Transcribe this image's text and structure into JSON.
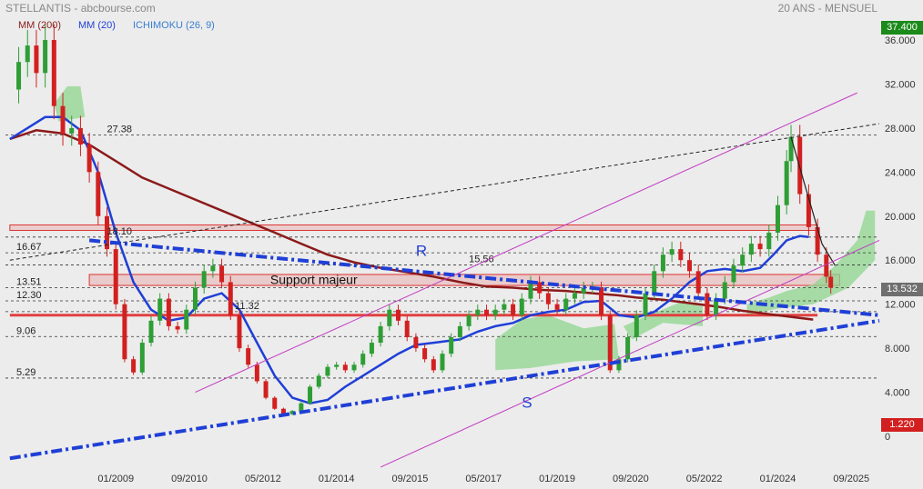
{
  "header": {
    "left": "STELLANTIS - abcbourse.com",
    "right": "20 ANS - MENSUEL"
  },
  "legend": [
    {
      "label": "MM (200)",
      "color": "#8b1a1a"
    },
    {
      "label": "MM (20)",
      "color": "#1f3fd6"
    },
    {
      "label": "ICHIMOKU (26, 9)",
      "color": "#3a7dd0"
    }
  ],
  "price_tags": {
    "high": "37.400",
    "last": "13.532",
    "low": "1.220"
  },
  "chart_data": {
    "type": "candlestick",
    "x_tick_labels": [
      "01/2009",
      "09/2010",
      "05/2012",
      "01/2014",
      "09/2015",
      "05/2017",
      "01/2019",
      "09/2020",
      "05/2022",
      "01/2024",
      "09/2025"
    ],
    "y_ticks": [
      0,
      4,
      8,
      12,
      16,
      20,
      24,
      28,
      32,
      36
    ],
    "y_tick_labels": [
      "0",
      "4.000",
      "8.000",
      "12.000",
      "16.000",
      "20.000",
      "24.000",
      "28.000",
      "32.000",
      "36.000"
    ],
    "ylim": [
      0,
      37.4
    ],
    "xlim": [
      2006.5,
      2026.3
    ],
    "colors": {
      "up": "#2e9e35",
      "down": "#d22020",
      "cloud": "#8fd68f",
      "ma200": "#8b1a1a",
      "ma20": "#1f3fd6",
      "trend": "#1f3fd6",
      "channel": "#c23cc2",
      "support": "#e04040"
    },
    "level_lines": [
      {
        "label": "27.38",
        "value": 27.38
      },
      {
        "label": "18.10",
        "value": 18.1
      },
      {
        "label": "16.67",
        "value": 16.67
      },
      {
        "label": "15.56",
        "value": 15.56
      },
      {
        "label": "13.51",
        "value": 13.51
      },
      {
        "label": "12.30",
        "value": 12.3
      },
      {
        "label": "11.32",
        "value": 11.32
      },
      {
        "label": "9.06",
        "value": 9.06
      },
      {
        "label": "5.29",
        "value": 5.29
      }
    ],
    "annotations": {
      "resistance": "R",
      "support": "S",
      "support_zone": "Support majeur"
    },
    "price_path": [
      [
        2006.6,
        31.5
      ],
      [
        2006.8,
        34.0
      ],
      [
        2007.0,
        35.5
      ],
      [
        2007.2,
        33.0
      ],
      [
        2007.4,
        36.0
      ],
      [
        2007.6,
        30.0
      ],
      [
        2007.8,
        27.5
      ],
      [
        2008.0,
        28.0
      ],
      [
        2008.2,
        26.5
      ],
      [
        2008.4,
        24.0
      ],
      [
        2008.6,
        20.0
      ],
      [
        2008.8,
        17.0
      ],
      [
        2009.0,
        12.0
      ],
      [
        2009.2,
        7.0
      ],
      [
        2009.4,
        5.8
      ],
      [
        2009.6,
        8.5
      ],
      [
        2009.8,
        10.5
      ],
      [
        2010.0,
        12.5
      ],
      [
        2010.2,
        10.0
      ],
      [
        2010.4,
        9.7
      ],
      [
        2010.6,
        11.5
      ],
      [
        2010.8,
        13.5
      ],
      [
        2011.0,
        15.0
      ],
      [
        2011.2,
        15.5
      ],
      [
        2011.4,
        14.0
      ],
      [
        2011.6,
        11.0
      ],
      [
        2011.8,
        8.0
      ],
      [
        2012.0,
        6.5
      ],
      [
        2012.2,
        5.0
      ],
      [
        2012.4,
        3.5
      ],
      [
        2012.6,
        2.5
      ],
      [
        2012.8,
        2.0
      ],
      [
        2013.0,
        2.3
      ],
      [
        2013.2,
        3.0
      ],
      [
        2013.4,
        4.5
      ],
      [
        2013.6,
        5.5
      ],
      [
        2013.8,
        6.3
      ],
      [
        2014.0,
        6.5
      ],
      [
        2014.2,
        6.0
      ],
      [
        2014.4,
        6.5
      ],
      [
        2014.6,
        7.5
      ],
      [
        2014.8,
        8.5
      ],
      [
        2015.0,
        10.0
      ],
      [
        2015.2,
        11.5
      ],
      [
        2015.4,
        10.5
      ],
      [
        2015.6,
        9.0
      ],
      [
        2015.8,
        8.0
      ],
      [
        2016.0,
        7.0
      ],
      [
        2016.2,
        6.0
      ],
      [
        2016.4,
        7.5
      ],
      [
        2016.6,
        9.0
      ],
      [
        2016.8,
        10.0
      ],
      [
        2017.0,
        11.0
      ],
      [
        2017.2,
        11.5
      ],
      [
        2017.4,
        11.0
      ],
      [
        2017.6,
        11.5
      ],
      [
        2017.8,
        12.0
      ],
      [
        2018.0,
        11.0
      ],
      [
        2018.2,
        12.5
      ],
      [
        2018.4,
        14.0
      ],
      [
        2018.6,
        13.0
      ],
      [
        2018.8,
        12.0
      ],
      [
        2019.0,
        11.5
      ],
      [
        2019.2,
        12.5
      ],
      [
        2019.4,
        13.0
      ],
      [
        2019.6,
        13.5
      ],
      [
        2019.8,
        13.5
      ],
      [
        2020.0,
        11.0
      ],
      [
        2020.2,
        6.0
      ],
      [
        2020.4,
        7.0
      ],
      [
        2020.6,
        9.0
      ],
      [
        2020.8,
        11.0
      ],
      [
        2021.0,
        13.0
      ],
      [
        2021.2,
        15.0
      ],
      [
        2021.4,
        16.5
      ],
      [
        2021.6,
        17.0
      ],
      [
        2021.8,
        16.0
      ],
      [
        2022.0,
        15.0
      ],
      [
        2022.2,
        13.0
      ],
      [
        2022.4,
        11.0
      ],
      [
        2022.6,
        12.5
      ],
      [
        2022.8,
        14.0
      ],
      [
        2023.0,
        15.5
      ],
      [
        2023.2,
        16.5
      ],
      [
        2023.4,
        17.5
      ],
      [
        2023.6,
        17.0
      ],
      [
        2023.8,
        18.5
      ],
      [
        2024.0,
        21.0
      ],
      [
        2024.2,
        25.0
      ],
      [
        2024.3,
        27.2
      ],
      [
        2024.5,
        22.0
      ],
      [
        2024.7,
        19.0
      ],
      [
        2024.9,
        16.5
      ],
      [
        2025.1,
        14.5
      ],
      [
        2025.2,
        13.5
      ]
    ],
    "ma200_path": [
      [
        2006.6,
        27.0
      ],
      [
        2007.2,
        27.8
      ],
      [
        2007.8,
        27.5
      ],
      [
        2008.4,
        26.5
      ],
      [
        2009.0,
        25.0
      ],
      [
        2009.6,
        23.5
      ],
      [
        2010.2,
        22.5
      ],
      [
        2010.8,
        21.5
      ],
      [
        2011.4,
        20.5
      ],
      [
        2012.0,
        19.5
      ],
      [
        2012.6,
        18.5
      ],
      [
        2013.2,
        17.5
      ],
      [
        2013.8,
        16.5
      ],
      [
        2014.4,
        15.8
      ],
      [
        2015.0,
        15.3
      ],
      [
        2015.6,
        14.9
      ],
      [
        2016.2,
        14.5
      ],
      [
        2016.8,
        14.0
      ],
      [
        2017.4,
        13.6
      ],
      [
        2018.0,
        13.5
      ],
      [
        2018.6,
        13.3
      ],
      [
        2019.2,
        13.2
      ],
      [
        2019.8,
        13.0
      ],
      [
        2020.4,
        12.8
      ],
      [
        2020.8,
        12.6
      ],
      [
        2021.4,
        12.4
      ],
      [
        2022.0,
        12.1
      ],
      [
        2022.6,
        11.8
      ],
      [
        2023.2,
        11.4
      ],
      [
        2023.8,
        11.1
      ],
      [
        2024.4,
        10.8
      ],
      [
        2024.8,
        10.6
      ]
    ],
    "ma20_path": [
      [
        2006.6,
        27.0
      ],
      [
        2007.0,
        28.0
      ],
      [
        2007.4,
        29.0
      ],
      [
        2007.8,
        29.0
      ],
      [
        2008.2,
        27.8
      ],
      [
        2008.6,
        24.0
      ],
      [
        2009.0,
        18.5
      ],
      [
        2009.4,
        14.0
      ],
      [
        2009.8,
        11.5
      ],
      [
        2010.2,
        10.5
      ],
      [
        2010.6,
        10.8
      ],
      [
        2011.0,
        12.5
      ],
      [
        2011.4,
        13.0
      ],
      [
        2011.8,
        11.5
      ],
      [
        2012.2,
        8.5
      ],
      [
        2012.6,
        5.5
      ],
      [
        2013.0,
        3.5
      ],
      [
        2013.4,
        3.0
      ],
      [
        2013.8,
        3.3
      ],
      [
        2014.2,
        4.5
      ],
      [
        2014.6,
        5.5
      ],
      [
        2015.0,
        6.5
      ],
      [
        2015.4,
        7.5
      ],
      [
        2015.8,
        8.3
      ],
      [
        2016.2,
        8.5
      ],
      [
        2016.8,
        8.8
      ],
      [
        2017.2,
        9.5
      ],
      [
        2017.6,
        10.0
      ],
      [
        2018.0,
        10.3
      ],
      [
        2018.4,
        11.0
      ],
      [
        2018.8,
        11.3
      ],
      [
        2019.2,
        11.5
      ],
      [
        2019.6,
        12.2
      ],
      [
        2020.0,
        12.3
      ],
      [
        2020.4,
        11.0
      ],
      [
        2020.8,
        10.8
      ],
      [
        2021.2,
        11.3
      ],
      [
        2021.6,
        12.5
      ],
      [
        2022.0,
        14.0
      ],
      [
        2022.4,
        15.0
      ],
      [
        2022.8,
        15.2
      ],
      [
        2023.2,
        15.0
      ],
      [
        2023.6,
        15.3
      ],
      [
        2023.9,
        16.5
      ],
      [
        2024.2,
        17.8
      ],
      [
        2024.5,
        18.2
      ],
      [
        2024.7,
        18.1
      ]
    ],
    "cloud_patches": [
      [
        [
          2007.6,
          30.2
        ],
        [
          2007.9,
          31.8
        ],
        [
          2008.2,
          31.8
        ],
        [
          2008.3,
          29.0
        ],
        [
          2007.7,
          28.6
        ]
      ],
      [
        [
          2017.6,
          8.8
        ],
        [
          2018.2,
          10.6
        ],
        [
          2018.8,
          11.0
        ],
        [
          2019.6,
          9.8
        ],
        [
          2020.3,
          10.2
        ],
        [
          2020.4,
          7.0
        ],
        [
          2019.4,
          6.8
        ],
        [
          2018.4,
          6.2
        ],
        [
          2017.6,
          6.0
        ]
      ],
      [
        [
          2020.5,
          10.0
        ],
        [
          2021.2,
          11.2
        ],
        [
          2021.8,
          12.2
        ],
        [
          2022.3,
          11.8
        ],
        [
          2022.3,
          10.0
        ],
        [
          2021.4,
          10.3
        ],
        [
          2020.7,
          8.8
        ]
      ],
      [
        [
          2023.3,
          12.0
        ],
        [
          2023.8,
          12.6
        ],
        [
          2024.2,
          13.2
        ],
        [
          2024.8,
          13.8
        ],
        [
          2025.3,
          15.5
        ],
        [
          2025.8,
          17.8
        ],
        [
          2026.0,
          20.5
        ],
        [
          2026.2,
          20.5
        ],
        [
          2026.2,
          16.0
        ],
        [
          2025.6,
          13.5
        ],
        [
          2024.8,
          12.0
        ],
        [
          2024.0,
          11.6
        ],
        [
          2023.3,
          11.0
        ]
      ]
    ],
    "trend_resistance": [
      [
        2008.4,
        17.8
      ],
      [
        2026.3,
        11.0
      ]
    ],
    "trend_support": [
      [
        2006.6,
        -2.0
      ],
      [
        2026.3,
        10.5
      ]
    ],
    "channel_upper": [
      [
        2010.8,
        4.0
      ],
      [
        2025.8,
        31.2
      ]
    ],
    "channel_lower": [
      [
        2015.0,
        -2.8
      ],
      [
        2026.3,
        17.8
      ]
    ],
    "dashed_upper": [
      [
        2006.6,
        16.0
      ],
      [
        2026.3,
        28.4
      ]
    ],
    "support_zone": [
      2008.4,
      2025.4,
      13.7,
      14.7
    ],
    "resist_zone": [
      2006.6,
      2024.9,
      19.2,
      18.7
    ],
    "support_line_value": 11.0,
    "support_line_range": [
      2006.6,
      2024.9
    ]
  }
}
